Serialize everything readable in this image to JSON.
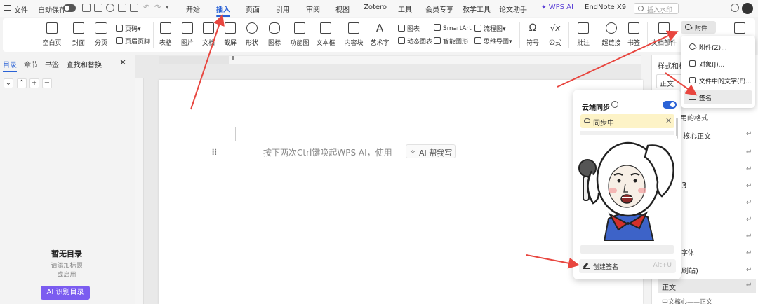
{
  "menubar": {
    "file": "文件",
    "autosave": "自动保存",
    "tabs": [
      "开始",
      "插入",
      "页面",
      "引用",
      "审阅",
      "视图",
      "Zotero",
      "工具",
      "会员专享",
      "教学工具",
      "论文助手",
      "WPS AI",
      "EndNote X9"
    ],
    "search_placeholder": "插入水印"
  },
  "ribbon": {
    "blank_page": "空白页",
    "cover": "封面",
    "page_break": "分页",
    "page_number": "页码",
    "header_footer": "页眉页脚",
    "table": "表格",
    "picture": "图片",
    "doc": "文档",
    "screenshot": "截屏",
    "shape": "形状",
    "icon": "图标",
    "function_chart": "功能图",
    "textbox": "文本框",
    "content_block": "内容块",
    "wordart": "艺术字",
    "chart": "图表",
    "smartart": "SmartArt",
    "dynamic_chart": "动态图表",
    "smart_graphic": "智能图形",
    "flowchart": "流程图",
    "mindmap": "思维导图",
    "symbol": "符号",
    "formula": "公式",
    "comment": "批注",
    "hyperlink": "超链接",
    "bookmark": "书签",
    "doc_parts": "文档部件",
    "attachment": "附件"
  },
  "attach_menu": {
    "items": [
      "附件(Z)...",
      "对象(J)...",
      "文件中的文字(F)...",
      "签名"
    ]
  },
  "left_panel": {
    "tabs": [
      "目录",
      "章节",
      "书签",
      "查找和替换"
    ],
    "empty_title": "暂无目录",
    "empty_hint1": "请添加标题",
    "empty_hint2": "或启用",
    "ai_toc_button": "AI 识别目录"
  },
  "document": {
    "hint": "按下两次Ctrl键唤起WPS AI，使用",
    "ai_write": "AI 帮我写"
  },
  "cloud_popup": {
    "title": "云端同步",
    "sync_status": "同步中",
    "create_signature": "创建签名",
    "shortcut": "Alt+U"
  },
  "right_panel": {
    "title": "样式和格",
    "current_style": "正文",
    "used_formats": "用的格式",
    "items": [
      "核心正文",
      "3",
      "字体",
      "刷站)",
      "正文",
      "中文核心——正文"
    ]
  },
  "colors": {
    "accent": "#2a62d6",
    "ai_purple": "#7b5cf0",
    "arrow": "#e8463f",
    "sync_bg": "#fdf3c7"
  }
}
